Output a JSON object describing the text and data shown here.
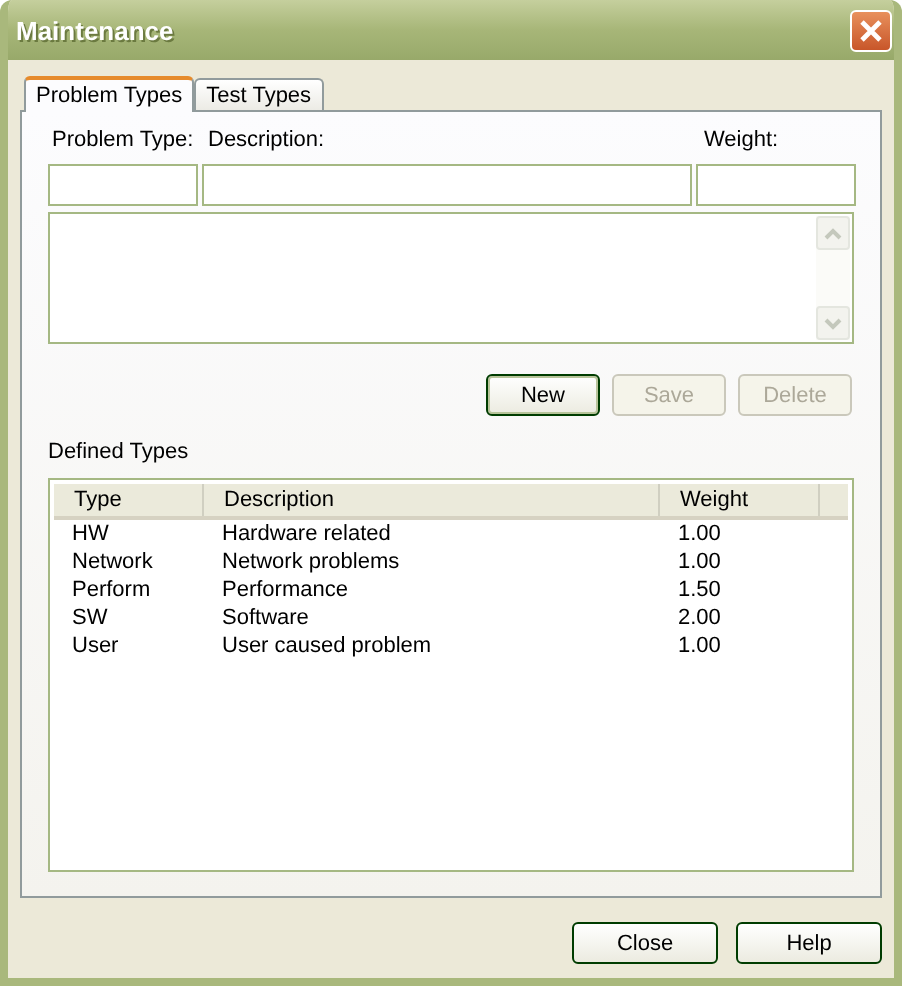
{
  "window": {
    "title": "Maintenance"
  },
  "tabs": [
    {
      "label": "Problem Types",
      "selected": true
    },
    {
      "label": "Test Types",
      "selected": false
    }
  ],
  "form": {
    "labels": [
      "Problem Type:",
      "Description:",
      "Weight:"
    ]
  },
  "actions": [
    {
      "label": "New",
      "disabled": false,
      "default": true
    },
    {
      "label": "Save",
      "disabled": true,
      "default": false
    },
    {
      "label": "Delete",
      "disabled": true,
      "default": false
    }
  ],
  "defined_types": {
    "title": "Defined Types",
    "columns": [
      "Type",
      "Description",
      "Weight"
    ],
    "rows": [
      [
        "HW",
        "Hardware related",
        "1.00"
      ],
      [
        "Network",
        "Network problems",
        "1.00"
      ],
      [
        "Perform",
        "Performance",
        "1.50"
      ],
      [
        "SW",
        "Software",
        "2.00"
      ],
      [
        "User",
        "User caused problem",
        "1.00"
      ]
    ]
  },
  "footer_buttons": [
    {
      "label": "Close"
    },
    {
      "label": "Help"
    }
  ]
}
